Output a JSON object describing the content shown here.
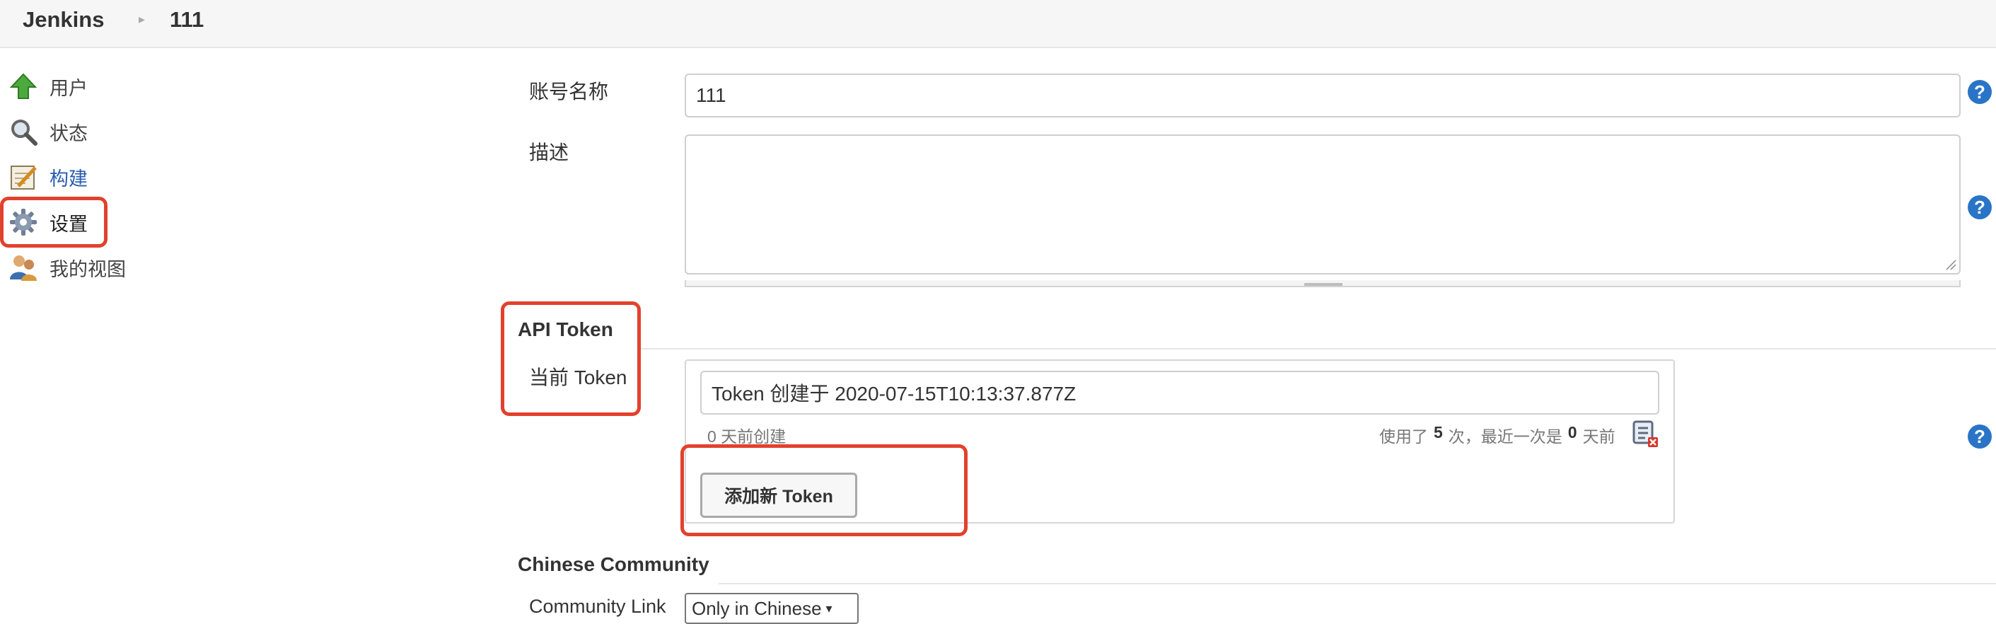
{
  "header": {
    "breadcrumb": [
      {
        "label": "Jenkins"
      },
      {
        "label": "111"
      }
    ]
  },
  "sidebar": {
    "items": [
      {
        "label": "用户",
        "icon": "up-arrow-icon"
      },
      {
        "label": "状态",
        "icon": "search-icon"
      },
      {
        "label": "构建",
        "icon": "notepad-icon"
      },
      {
        "label": "设置",
        "icon": "gear-icon"
      },
      {
        "label": "我的视图",
        "icon": "people-icon"
      }
    ]
  },
  "form": {
    "account_name_label": "账号名称",
    "account_name_value": "111",
    "description_label": "描述",
    "description_value": "",
    "help_symbol": "?",
    "api_token": {
      "section_title": "API Token",
      "current_label": "当前 Token",
      "token_name_value": "Token 创建于 2020-07-15T10:13:37.877Z",
      "created_ago": "0 天前创建",
      "usage_prefix": "使用了",
      "usage_count": "5",
      "usage_mid": "次，最近一次是",
      "last_use_days": "0",
      "usage_suffix": "天前",
      "add_button": "添加新 Token"
    },
    "community": {
      "section_title": "Chinese Community",
      "link_label": "Community Link",
      "select_value": "Only in Chinese"
    }
  },
  "colors": {
    "highlight": "#e2412d",
    "help_badge": "#2a74c7"
  }
}
